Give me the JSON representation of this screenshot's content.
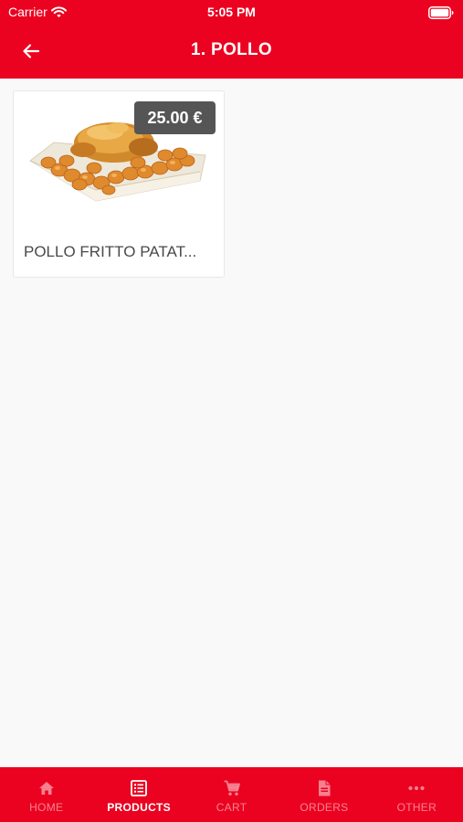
{
  "status_bar": {
    "carrier": "Carrier",
    "time": "5:05 PM",
    "wifi_icon": "wifi-icon",
    "battery_icon": "battery-icon"
  },
  "header": {
    "title": "1. POLLO",
    "back_icon": "arrow-left-icon"
  },
  "products": [
    {
      "name": "POLLO FRITTO PATAT...",
      "price": "25.00 €",
      "image_icon": "roast-chicken-with-potatoes"
    }
  ],
  "tabs": [
    {
      "label": "HOME",
      "icon": "home-icon",
      "active": false
    },
    {
      "label": "PRODUCTS",
      "icon": "list-icon",
      "active": true
    },
    {
      "label": "CART",
      "icon": "cart-icon",
      "active": false
    },
    {
      "label": "ORDERS",
      "icon": "document-icon",
      "active": false
    },
    {
      "label": "OTHER",
      "icon": "more-icon",
      "active": false
    }
  ],
  "colors": {
    "brand_red": "#eb0220",
    "background": "#f9f9f9",
    "price_badge": "#555555",
    "product_name": "#4a4a4a"
  }
}
